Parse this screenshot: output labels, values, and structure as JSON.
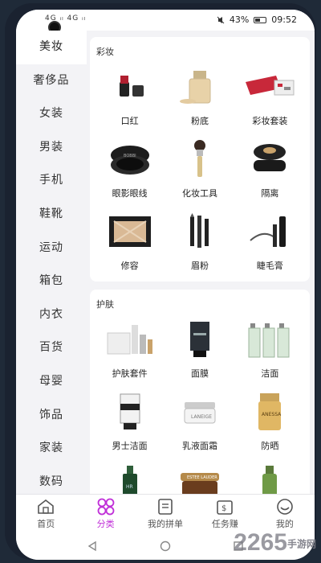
{
  "status_bar": {
    "signal_text": "4G ᵢₗ 4G ᵢₗ",
    "battery_percent": "43%",
    "time": "09:52"
  },
  "sidebar": {
    "items": [
      {
        "label": "美妆",
        "active": true
      },
      {
        "label": "奢侈品",
        "active": false
      },
      {
        "label": "女装",
        "active": false
      },
      {
        "label": "男装",
        "active": false
      },
      {
        "label": "手机",
        "active": false
      },
      {
        "label": "鞋靴",
        "active": false
      },
      {
        "label": "运动",
        "active": false
      },
      {
        "label": "箱包",
        "active": false
      },
      {
        "label": "内衣",
        "active": false
      },
      {
        "label": "百货",
        "active": false
      },
      {
        "label": "母婴",
        "active": false
      },
      {
        "label": "饰品",
        "active": false
      },
      {
        "label": "家装",
        "active": false
      },
      {
        "label": "数码",
        "active": false
      }
    ]
  },
  "sections": [
    {
      "title": "彩妆",
      "items": [
        {
          "label": "口红",
          "icon": "lipstick-icon"
        },
        {
          "label": "粉底",
          "icon": "foundation-bottle-icon"
        },
        {
          "label": "彩妆套装",
          "icon": "makeup-set-icon"
        },
        {
          "label": "眼影眼线",
          "icon": "eyeshadow-icon"
        },
        {
          "label": "化妆工具",
          "icon": "makeup-brush-icon"
        },
        {
          "label": "隔离",
          "icon": "cushion-compact-icon"
        },
        {
          "label": "修容",
          "icon": "contour-palette-icon"
        },
        {
          "label": "眉粉",
          "icon": "eyebrow-pencil-icon"
        },
        {
          "label": "睫毛膏",
          "icon": "mascara-icon"
        }
      ]
    },
    {
      "title": "护肤",
      "items": [
        {
          "label": "护肤套件",
          "icon": "skincare-set-icon"
        },
        {
          "label": "面膜",
          "icon": "face-mask-tube-icon"
        },
        {
          "label": "洁面",
          "icon": "cleanser-bottles-icon"
        },
        {
          "label": "男士洁面",
          "icon": "men-cleanser-icon"
        },
        {
          "label": "乳液面霜",
          "icon": "cream-jar-icon"
        },
        {
          "label": "防晒",
          "icon": "sunscreen-bottle-icon"
        },
        {
          "label": "",
          "icon": "serum-bottle-icon"
        },
        {
          "label": "",
          "icon": "eye-cream-jar-icon"
        },
        {
          "label": "",
          "icon": "green-bottle-icon"
        }
      ]
    }
  ],
  "bottom_nav": [
    {
      "label": "首页",
      "icon": "home-icon",
      "active": false
    },
    {
      "label": "分类",
      "icon": "category-icon",
      "active": true
    },
    {
      "label": "我的拼单",
      "icon": "group-order-icon",
      "active": false
    },
    {
      "label": "任务赚",
      "icon": "task-earn-icon",
      "active": false
    },
    {
      "label": "我的",
      "icon": "profile-icon",
      "active": false
    }
  ],
  "watermark": {
    "main": "2265",
    "sub": "手游网"
  },
  "colors": {
    "accent": "#c02fd8",
    "background": "#f3f3f6"
  }
}
